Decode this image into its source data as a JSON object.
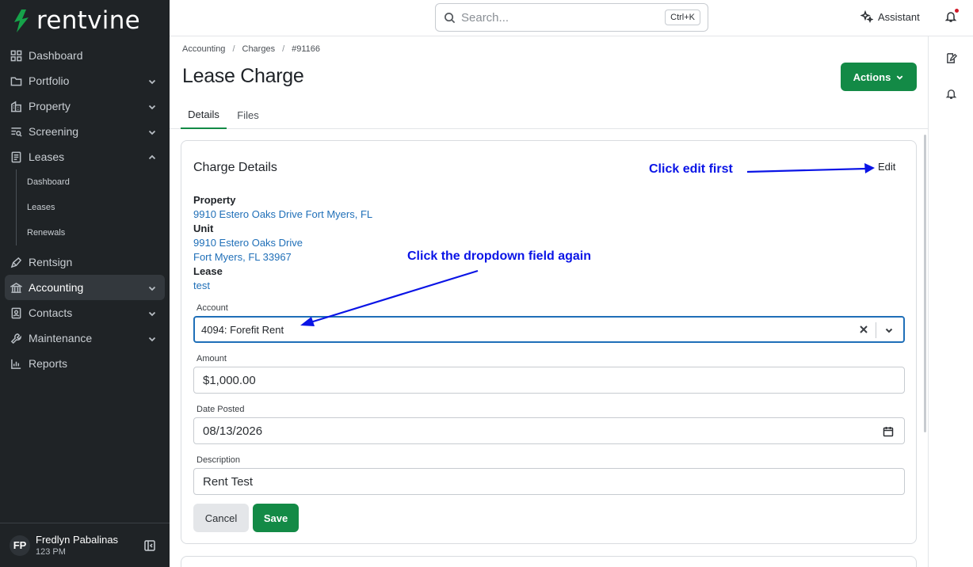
{
  "brand": {
    "name": "rentvine",
    "accent": "#138a46"
  },
  "sidebar": {
    "items": [
      {
        "label": "Dashboard",
        "icon": "dashboard-icon",
        "chevron": false
      },
      {
        "label": "Portfolio",
        "icon": "folder-icon",
        "chevron": true
      },
      {
        "label": "Property",
        "icon": "building-icon",
        "chevron": true
      },
      {
        "label": "Screening",
        "icon": "screening-icon",
        "chevron": true
      },
      {
        "label": "Leases",
        "icon": "lease-icon",
        "chevron": true,
        "expanded": true
      },
      {
        "label": "Rentsign",
        "icon": "sign-icon",
        "chevron": false
      },
      {
        "label": "Accounting",
        "icon": "bank-icon",
        "chevron": true,
        "active": true
      },
      {
        "label": "Contacts",
        "icon": "contacts-icon",
        "chevron": true
      },
      {
        "label": "Maintenance",
        "icon": "wrench-icon",
        "chevron": true
      },
      {
        "label": "Reports",
        "icon": "reports-icon",
        "chevron": false
      }
    ],
    "leases_sub": [
      "Dashboard",
      "Leases",
      "Renewals"
    ],
    "user": {
      "initials": "FP",
      "name": "Fredlyn Pabalinas",
      "sub": "123 PM"
    }
  },
  "topbar": {
    "search_placeholder": "Search...",
    "search_shortcut": "Ctrl+K",
    "assistant_label": "Assistant"
  },
  "breadcrumb": [
    "Accounting",
    "Charges",
    "#91166"
  ],
  "page_title": "Lease Charge",
  "actions_label": "Actions",
  "tabs": [
    "Details",
    "Files"
  ],
  "card": {
    "title": "Charge Details",
    "edit_label": "Edit",
    "property_label": "Property",
    "property_value": "9910 Estero Oaks Drive Fort Myers, FL",
    "unit_label": "Unit",
    "unit_line1": "9910 Estero Oaks Drive",
    "unit_line2": "Fort Myers, FL 33967",
    "lease_label": "Lease",
    "lease_value": "test",
    "account_label": "Account",
    "account_value": "4094: Forefit Rent",
    "amount_label": "Amount",
    "amount_value": "$1,000.00",
    "date_label": "Date Posted",
    "date_value": "08/13/2026",
    "description_label": "Description",
    "description_value": "Rent Test",
    "cancel_label": "Cancel",
    "save_label": "Save"
  },
  "annotations": {
    "edit_hint": "Click edit first",
    "dropdown_hint": "Click the dropdown field again",
    "color": "#0a14e6"
  }
}
